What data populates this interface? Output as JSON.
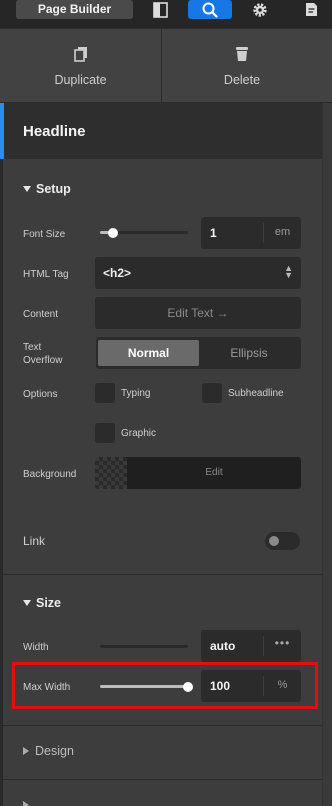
{
  "topbar": {
    "page_builder_label": "Page Builder",
    "icons": [
      "panel-icon",
      "search-icon",
      "gear-icon",
      "page-icon"
    ],
    "active_color": "#1677e5"
  },
  "actions": {
    "duplicate_label": "Duplicate",
    "delete_label": "Delete"
  },
  "element": {
    "title": "Headline",
    "accent_color": "#2a8bf2"
  },
  "setup": {
    "title": "Setup",
    "font_size": {
      "label": "Font Size",
      "value": "1",
      "unit": "em",
      "slider_fraction": 0.15
    },
    "html_tag": {
      "label": "HTML Tag",
      "value": "<h2>"
    },
    "content": {
      "label": "Content",
      "button_label": "Edit Text →"
    },
    "text_overflow": {
      "label_line1": "Text",
      "label_line2": "Overflow",
      "options": [
        "Normal",
        "Ellipsis"
      ],
      "selected": "Normal"
    },
    "options": {
      "label": "Options",
      "typing": "Typing",
      "subheadline": "Subheadline",
      "graphic": "Graphic"
    },
    "background": {
      "label": "Background",
      "edit_label": "Edit"
    },
    "link": {
      "label": "Link",
      "enabled": false
    }
  },
  "size": {
    "title": "Size",
    "width": {
      "label": "Width",
      "value": "auto",
      "more": "•••"
    },
    "max_width": {
      "label": "Max Width",
      "value": "100",
      "unit": "%",
      "slider_fraction": 1.0
    }
  },
  "design": {
    "title": "Design"
  },
  "highlight_color": "#e01010"
}
